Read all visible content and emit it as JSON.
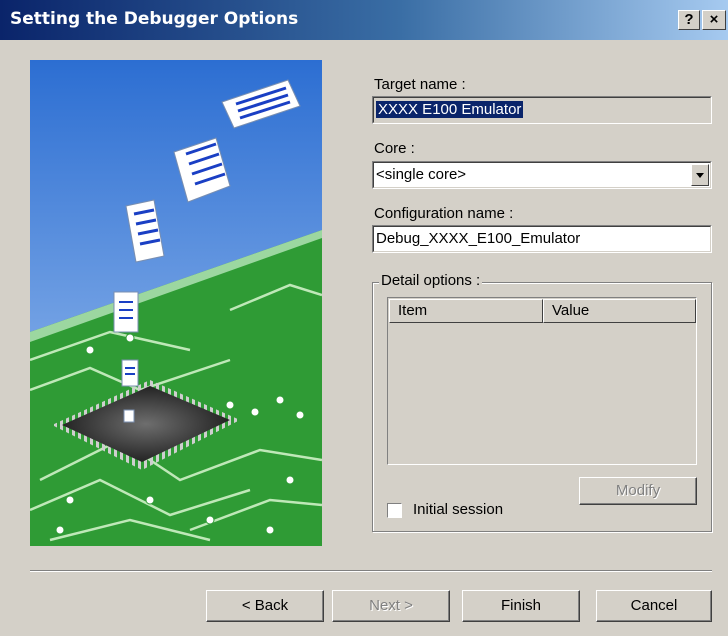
{
  "window": {
    "title": "Setting the Debugger Options",
    "help_label": "?",
    "close_label": "×"
  },
  "form": {
    "target_name_label": "Target name :",
    "target_name_value": "XXXX E100 Emulator",
    "core_label": "Core :",
    "core_value": "<single core>",
    "configuration_name_label": "Configuration name :",
    "configuration_name_value": "Debug_XXXX_E100_Emulator"
  },
  "detail_options": {
    "group_label": "Detail options :",
    "columns": [
      "Item",
      "Value"
    ],
    "modify_label": "Modify",
    "initial_session_label": "Initial session",
    "initial_session_checked": false
  },
  "buttons": {
    "back": "< Back",
    "next": "Next >",
    "finish": "Finish",
    "cancel": "Cancel"
  }
}
